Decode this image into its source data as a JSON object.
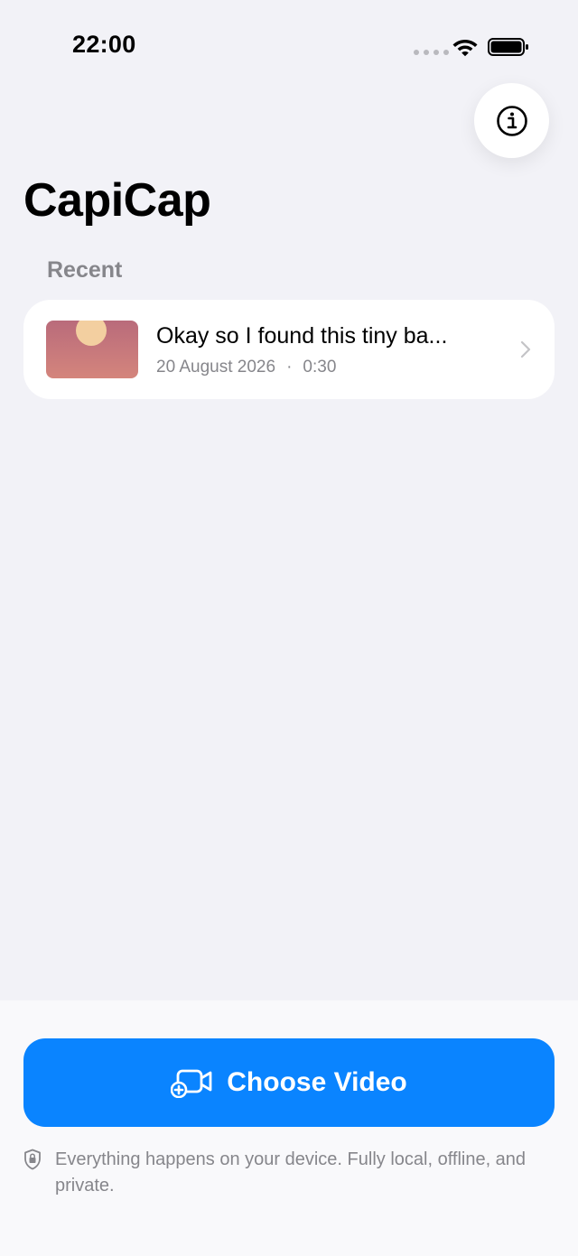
{
  "status_bar": {
    "time": "22:00",
    "icons": [
      "signal-dots-icon",
      "wifi-icon",
      "battery-icon"
    ]
  },
  "header": {
    "info_icon": "info-circle-icon",
    "title": "CapiCap"
  },
  "recent": {
    "section_label": "Recent",
    "items": [
      {
        "title": "Okay so I found this tiny ba...",
        "date": "20 August 2026",
        "separator": "·",
        "duration": "0:30",
        "thumbnail_icon": "sunset-thumbnail",
        "chevron_icon": "chevron-right-icon"
      }
    ]
  },
  "footer": {
    "choose_label": "Choose Video",
    "choose_icon": "video-add-icon",
    "privacy_icon": "lock-shield-icon",
    "privacy_text": "Everything happens on your device. Fully local, offline, and private."
  },
  "colors": {
    "accent": "#0a84ff",
    "background": "#f2f2f7",
    "card": "#ffffff",
    "secondary_text": "#86868b"
  }
}
